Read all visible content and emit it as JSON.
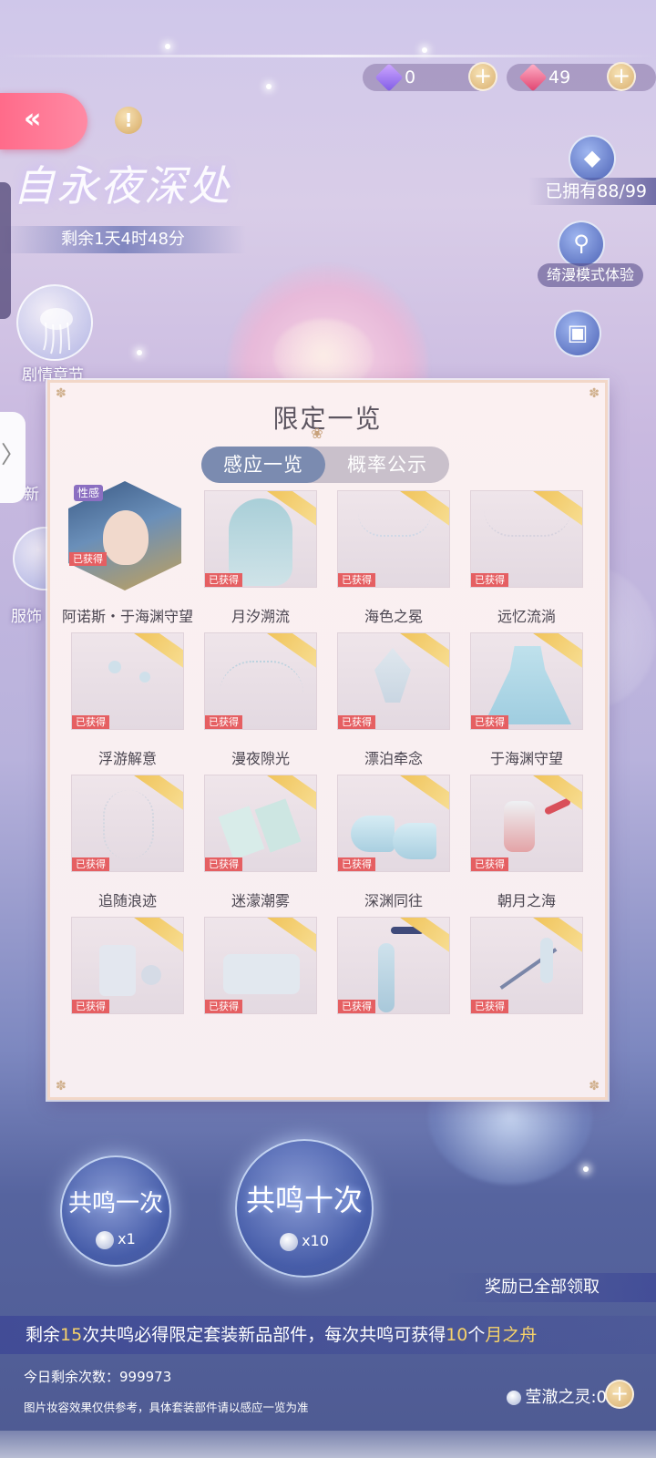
{
  "currency": {
    "diamond_count": "0",
    "gem_count": "49",
    "add_symbol": "+"
  },
  "header": {
    "back_glyph": "«",
    "info_glyph": "!",
    "event_title": "自永夜深处",
    "countdown": "剩余1天4时48分"
  },
  "left_menu": {
    "story_label": "剧情章节",
    "partial_label_1": "新",
    "partial_label_2": "服饰",
    "drawer_glyph": "〉"
  },
  "right_menu": {
    "owned": "已拥有88/99",
    "preview_label": "绮漫模式体验"
  },
  "modal": {
    "title": "限定一览",
    "title_ornament": "❀",
    "corner_glyph": "✽",
    "tabs": [
      {
        "label": "感应一览",
        "active": true
      },
      {
        "label": "概率公示",
        "active": false
      }
    ],
    "acquired_text": "已获得",
    "special_tag": "性感",
    "items": [
      {
        "name": "阿诺斯・于海渊守望"
      },
      {
        "name": "月汐溯流"
      },
      {
        "name": "海色之冕"
      },
      {
        "name": "远忆流淌"
      },
      {
        "name": "浮游解意"
      },
      {
        "name": "漫夜隙光"
      },
      {
        "name": "漂泊牵念"
      },
      {
        "name": "于海渊守望"
      },
      {
        "name": "追随浪迹"
      },
      {
        "name": "迷濛潮雾"
      },
      {
        "name": "深渊同往"
      },
      {
        "name": "朝月之海"
      },
      {
        "name": ""
      },
      {
        "name": ""
      },
      {
        "name": ""
      },
      {
        "name": ""
      }
    ]
  },
  "draw": {
    "single_label": "共鸣一次",
    "single_count": "x1",
    "ten_label": "共鸣十次",
    "ten_count": "x10"
  },
  "rewards_status": "奖励已全部领取",
  "promo": {
    "prefix": "剩余",
    "remaining_draws": "15",
    "middle": "次共鸣必得限定套装新品部件，每次共鸣可获得",
    "boat_count": "10",
    "unit": "个",
    "item": "月之舟"
  },
  "daily_remaining": "今日剩余次数：999973",
  "disclaimer": "图片妆容效果仅供参考，具体套装部件请以感应一览为准",
  "spirit_count": "莹澈之灵:0",
  "colors": {
    "accent_pink": "#ff6b8a",
    "acquired_red": "#e55f62",
    "gold": "#f0c257",
    "tab_active": "#7b8bb0"
  }
}
